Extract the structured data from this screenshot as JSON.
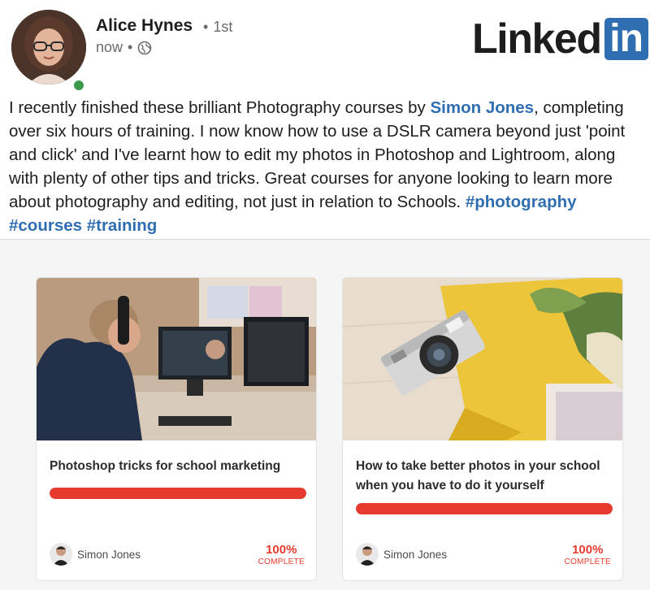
{
  "brand": {
    "logo_text": "Linked",
    "logo_box_text": "in",
    "accent_color": "#2f6eb1"
  },
  "post": {
    "author": {
      "name": "Alice Hynes",
      "degree": "1st",
      "online": true
    },
    "timestamp": "now",
    "visibility_icon": "globe-icon",
    "text_parts": {
      "p1": "I recently finished these brilliant Photography courses by ",
      "mention": "Simon Jones",
      "p2": ", completing over six hours of training. I now know how to use a DSLR camera beyond just 'point and click' and I've learnt how to edit my photos in Photoshop and Lightroom, along with plenty of other tips and tricks. Great courses for anyone looking to learn more about photography and editing, not just in relation to Schools.  ",
      "hashtags": "#photography #courses #training"
    }
  },
  "courses": [
    {
      "title": "Photoshop tricks for school marketing",
      "instructor": "Simon Jones",
      "progress_percent": 100,
      "completion_pct_text": "100%",
      "completion_label": "COMPLETE",
      "image_subject": "person editing photos at desk with monitors"
    },
    {
      "title": "How to take better photos in your school when you have to do it yourself",
      "instructor": "Simon Jones",
      "progress_percent": 100,
      "completion_pct_text": "100%",
      "completion_label": "COMPLETE",
      "image_subject": "film camera on yellow cloth with plant"
    }
  ],
  "colors": {
    "progress": "#e63a2e",
    "presence": "#3d9a4a"
  }
}
